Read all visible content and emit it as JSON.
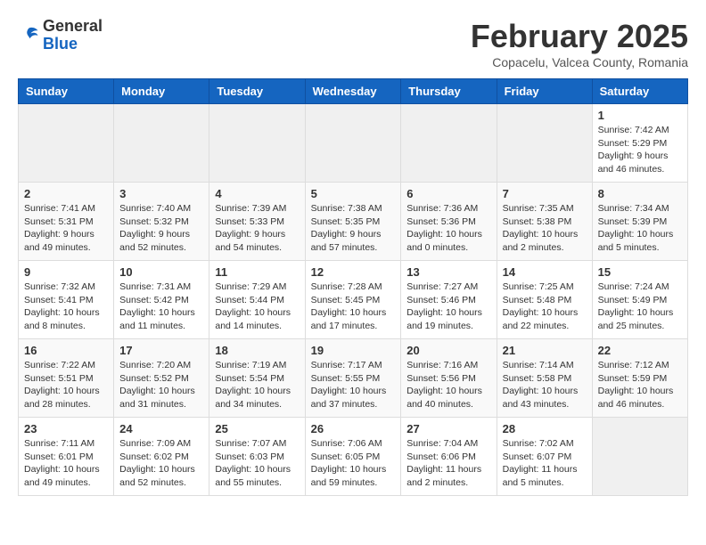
{
  "header": {
    "logo_general": "General",
    "logo_blue": "Blue",
    "month_title": "February 2025",
    "location": "Copacelu, Valcea County, Romania"
  },
  "weekdays": [
    "Sunday",
    "Monday",
    "Tuesday",
    "Wednesday",
    "Thursday",
    "Friday",
    "Saturday"
  ],
  "weeks": [
    [
      {
        "day": "",
        "info": ""
      },
      {
        "day": "",
        "info": ""
      },
      {
        "day": "",
        "info": ""
      },
      {
        "day": "",
        "info": ""
      },
      {
        "day": "",
        "info": ""
      },
      {
        "day": "",
        "info": ""
      },
      {
        "day": "1",
        "info": "Sunrise: 7:42 AM\nSunset: 5:29 PM\nDaylight: 9 hours and 46 minutes."
      }
    ],
    [
      {
        "day": "2",
        "info": "Sunrise: 7:41 AM\nSunset: 5:31 PM\nDaylight: 9 hours and 49 minutes."
      },
      {
        "day": "3",
        "info": "Sunrise: 7:40 AM\nSunset: 5:32 PM\nDaylight: 9 hours and 52 minutes."
      },
      {
        "day": "4",
        "info": "Sunrise: 7:39 AM\nSunset: 5:33 PM\nDaylight: 9 hours and 54 minutes."
      },
      {
        "day": "5",
        "info": "Sunrise: 7:38 AM\nSunset: 5:35 PM\nDaylight: 9 hours and 57 minutes."
      },
      {
        "day": "6",
        "info": "Sunrise: 7:36 AM\nSunset: 5:36 PM\nDaylight: 10 hours and 0 minutes."
      },
      {
        "day": "7",
        "info": "Sunrise: 7:35 AM\nSunset: 5:38 PM\nDaylight: 10 hours and 2 minutes."
      },
      {
        "day": "8",
        "info": "Sunrise: 7:34 AM\nSunset: 5:39 PM\nDaylight: 10 hours and 5 minutes."
      }
    ],
    [
      {
        "day": "9",
        "info": "Sunrise: 7:32 AM\nSunset: 5:41 PM\nDaylight: 10 hours and 8 minutes."
      },
      {
        "day": "10",
        "info": "Sunrise: 7:31 AM\nSunset: 5:42 PM\nDaylight: 10 hours and 11 minutes."
      },
      {
        "day": "11",
        "info": "Sunrise: 7:29 AM\nSunset: 5:44 PM\nDaylight: 10 hours and 14 minutes."
      },
      {
        "day": "12",
        "info": "Sunrise: 7:28 AM\nSunset: 5:45 PM\nDaylight: 10 hours and 17 minutes."
      },
      {
        "day": "13",
        "info": "Sunrise: 7:27 AM\nSunset: 5:46 PM\nDaylight: 10 hours and 19 minutes."
      },
      {
        "day": "14",
        "info": "Sunrise: 7:25 AM\nSunset: 5:48 PM\nDaylight: 10 hours and 22 minutes."
      },
      {
        "day": "15",
        "info": "Sunrise: 7:24 AM\nSunset: 5:49 PM\nDaylight: 10 hours and 25 minutes."
      }
    ],
    [
      {
        "day": "16",
        "info": "Sunrise: 7:22 AM\nSunset: 5:51 PM\nDaylight: 10 hours and 28 minutes."
      },
      {
        "day": "17",
        "info": "Sunrise: 7:20 AM\nSunset: 5:52 PM\nDaylight: 10 hours and 31 minutes."
      },
      {
        "day": "18",
        "info": "Sunrise: 7:19 AM\nSunset: 5:54 PM\nDaylight: 10 hours and 34 minutes."
      },
      {
        "day": "19",
        "info": "Sunrise: 7:17 AM\nSunset: 5:55 PM\nDaylight: 10 hours and 37 minutes."
      },
      {
        "day": "20",
        "info": "Sunrise: 7:16 AM\nSunset: 5:56 PM\nDaylight: 10 hours and 40 minutes."
      },
      {
        "day": "21",
        "info": "Sunrise: 7:14 AM\nSunset: 5:58 PM\nDaylight: 10 hours and 43 minutes."
      },
      {
        "day": "22",
        "info": "Sunrise: 7:12 AM\nSunset: 5:59 PM\nDaylight: 10 hours and 46 minutes."
      }
    ],
    [
      {
        "day": "23",
        "info": "Sunrise: 7:11 AM\nSunset: 6:01 PM\nDaylight: 10 hours and 49 minutes."
      },
      {
        "day": "24",
        "info": "Sunrise: 7:09 AM\nSunset: 6:02 PM\nDaylight: 10 hours and 52 minutes."
      },
      {
        "day": "25",
        "info": "Sunrise: 7:07 AM\nSunset: 6:03 PM\nDaylight: 10 hours and 55 minutes."
      },
      {
        "day": "26",
        "info": "Sunrise: 7:06 AM\nSunset: 6:05 PM\nDaylight: 10 hours and 59 minutes."
      },
      {
        "day": "27",
        "info": "Sunrise: 7:04 AM\nSunset: 6:06 PM\nDaylight: 11 hours and 2 minutes."
      },
      {
        "day": "28",
        "info": "Sunrise: 7:02 AM\nSunset: 6:07 PM\nDaylight: 11 hours and 5 minutes."
      },
      {
        "day": "",
        "info": ""
      }
    ]
  ]
}
